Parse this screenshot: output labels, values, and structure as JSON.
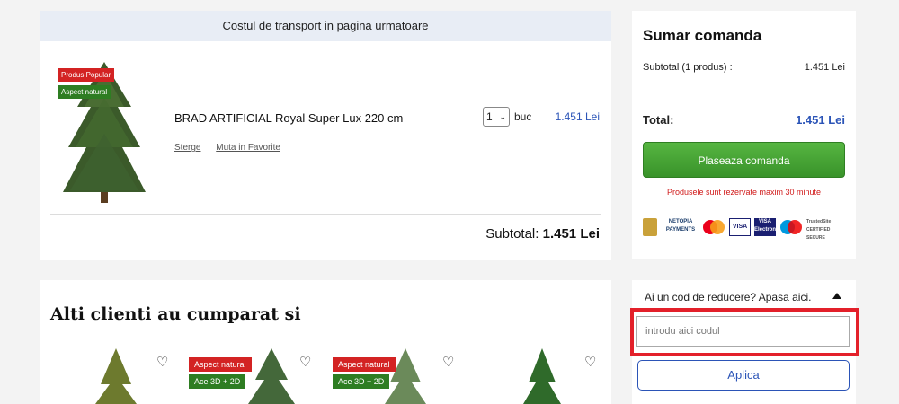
{
  "cart": {
    "shipping_banner": "Costul de transport in pagina urmatoare",
    "item": {
      "badges": [
        "Produs Popular",
        "Aspect natural"
      ],
      "name": "BRAD ARTIFICIAL Royal Super Lux 220 cm",
      "links": {
        "delete": "Sterge",
        "favorite": "Muta in Favorite"
      },
      "quantity": "1",
      "unit": "buc",
      "price": "1.451 Lei"
    },
    "subtotal_label": "Subtotal:",
    "subtotal_value": "1.451 Lei"
  },
  "summary": {
    "title": "Sumar comanda",
    "subtotal_label": "Subtotal (1 produs) :",
    "subtotal_value": "1.451 Lei",
    "total_label": "Total:",
    "total_value": "1.451 Lei",
    "place_order_label": "Plaseaza comanda",
    "reserve_note": "Produsele sunt rezervate maxim 30 minute",
    "payment_logos": [
      "netopia-shield-icon",
      "NETOPIA PAYMENTS",
      "MasterCard",
      "VISA",
      "VISA Electron",
      "Maestro",
      "TrustedSite CERTIFIED SECURE"
    ]
  },
  "others": {
    "title": "Alti clienti au cumparat si",
    "products": [
      {
        "badges": []
      },
      {
        "badges": [
          "Aspect natural",
          "Ace 3D + 2D"
        ]
      },
      {
        "badges": [
          "Aspect natural",
          "Ace 3D + 2D"
        ]
      },
      {
        "badges": []
      }
    ]
  },
  "discount": {
    "title": "Ai un cod de reducere? Apasa aici.",
    "placeholder": "introdu aici codul",
    "apply_label": "Aplica"
  },
  "colors": {
    "accent_blue": "#2b54b7",
    "green_button": "#46a535",
    "badge_red": "#d32323",
    "badge_green": "#2e7d22",
    "highlight_red": "#e3202a"
  }
}
